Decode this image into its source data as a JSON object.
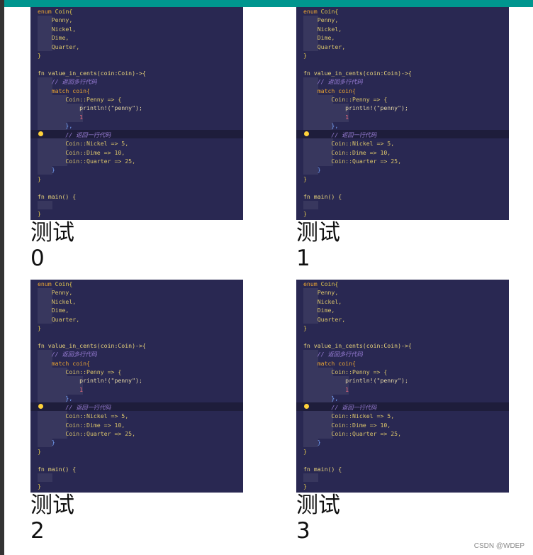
{
  "items": [
    {
      "label": "测试",
      "index": "0"
    },
    {
      "label": "测试",
      "index": "1"
    },
    {
      "label": "测试",
      "index": "2"
    },
    {
      "label": "测试",
      "index": "3"
    }
  ],
  "code": {
    "lines": [
      "enum Coin{",
      "    Penny,",
      "    Nickel,",
      "    Dime,",
      "    Quarter,",
      "}",
      "",
      "fn value_in_cents(coin:Coin)->{",
      "    // 返回多行代码",
      "    match coin{",
      "        Coin::Penny => {",
      "            println!(\"penny\");",
      "            1",
      "        },",
      "        // 返回一行代码",
      "        Coin::Nickel => 5,",
      "        Coin::Dime => 10,",
      "        Coin::Quarter => 25,",
      "    }",
      "}",
      "",
      "fn main() {",
      "",
      "}"
    ]
  },
  "watermark": "CSDN @WDEP",
  "colors": {
    "accent_bar": "#00968f",
    "editor_background": "#292852",
    "highlight_line": "#1e1d3b",
    "lightbulb": "#ffd23a"
  }
}
